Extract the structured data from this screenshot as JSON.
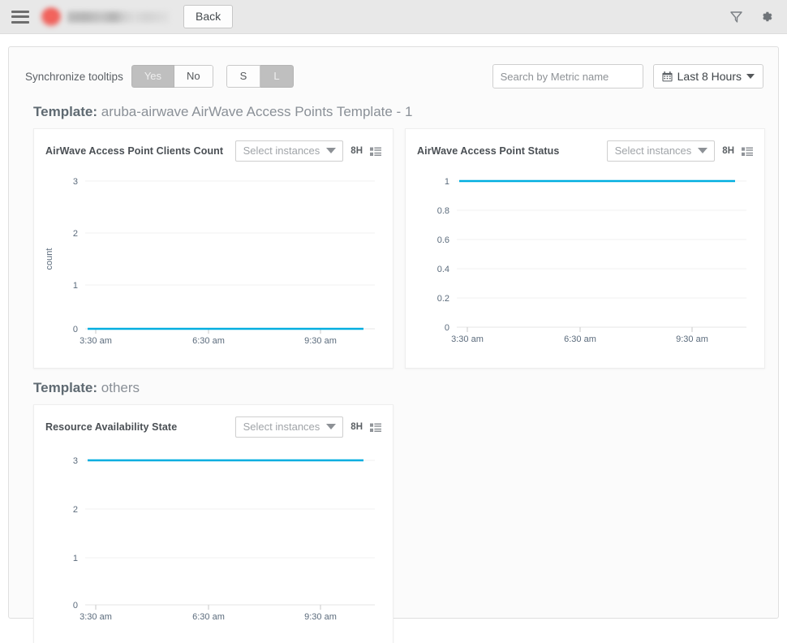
{
  "topbar": {
    "menu_icon": "hamburger-menu-icon",
    "logo": "redacted-brand-logo",
    "back_label": "Back",
    "filter_icon": "filter-funnel-icon",
    "settings_icon": "gear-icon"
  },
  "controls": {
    "sync_label": "Synchronize tooltips",
    "sync_yes": "Yes",
    "sync_no": "No",
    "sync_selected": "Yes",
    "size_s": "S",
    "size_l": "L",
    "size_selected": "L",
    "search_placeholder": "Search by Metric name",
    "search_value": "",
    "time_range": "Last 8 Hours",
    "calendar_icon": "calendar-icon",
    "caret_icon": "chevron-down-icon"
  },
  "colors": {
    "series": "#00aeE0",
    "topbar_bg": "#e8e8e8",
    "panel_bg": "#fbfbfb",
    "card_bg": "#ffffff",
    "tick_text": "#5b6b7c",
    "grid": "#f2f2f2",
    "segment_active": "#bfbfbf"
  },
  "sections": [
    {
      "label_prefix": "Template:",
      "label_value": "aruba-airwave AirWave Access Points Template - 1",
      "cards": [
        {
          "title": "AirWave Access Point Clients Count",
          "select_instances": "Select instances",
          "range_badge": "8H",
          "legend_icon": "legend-list-icon"
        },
        {
          "title": "AirWave Access Point Status",
          "select_instances": "Select instances",
          "range_badge": "8H",
          "legend_icon": "legend-list-icon"
        }
      ]
    },
    {
      "label_prefix": "Template:",
      "label_value": "others",
      "cards": [
        {
          "title": "Resource Availability State",
          "select_instances": "Select instances",
          "range_badge": "8H",
          "legend_icon": "legend-list-icon"
        }
      ]
    }
  ],
  "chart_data": [
    {
      "type": "line",
      "title": "AirWave Access Point Clients Count",
      "xlabel": "",
      "ylabel": "count",
      "ylim": [
        0,
        3
      ],
      "yticks": [
        0,
        1,
        2,
        3
      ],
      "ytick_labels": [
        "0",
        "1",
        "2",
        "3"
      ],
      "xtick_labels": [
        "3:30 am",
        "6:30 am",
        "9:30 am"
      ],
      "grid": true,
      "legend": "none",
      "series": [
        {
          "name": "clients count",
          "color": "#00aeE0",
          "x": [
            0,
            1
          ],
          "values": [
            0,
            0
          ]
        }
      ]
    },
    {
      "type": "line",
      "title": "AirWave Access Point Status",
      "xlabel": "",
      "ylabel": "",
      "ylim": [
        0,
        1
      ],
      "yticks": [
        0,
        0.2,
        0.4,
        0.6,
        0.8,
        1
      ],
      "ytick_labels": [
        "0",
        "0.2",
        "0.4",
        "0.6",
        "0.8",
        "1"
      ],
      "xtick_labels": [
        "3:30 am",
        "6:30 am",
        "9:30 am"
      ],
      "grid": true,
      "legend": "none",
      "series": [
        {
          "name": "status",
          "color": "#00aeE0",
          "x": [
            0,
            1
          ],
          "values": [
            1,
            1
          ]
        }
      ]
    },
    {
      "type": "line",
      "title": "Resource Availability State",
      "xlabel": "",
      "ylabel": "",
      "ylim": [
        0,
        3
      ],
      "yticks": [
        0,
        1,
        2,
        3
      ],
      "ytick_labels": [
        "0",
        "1",
        "2",
        "3"
      ],
      "xtick_labels": [
        "3:30 am",
        "6:30 am",
        "9:30 am"
      ],
      "grid": true,
      "legend": "none",
      "series": [
        {
          "name": "availability state",
          "color": "#00aeE0",
          "x": [
            0,
            1
          ],
          "values": [
            3,
            3
          ]
        }
      ]
    }
  ]
}
